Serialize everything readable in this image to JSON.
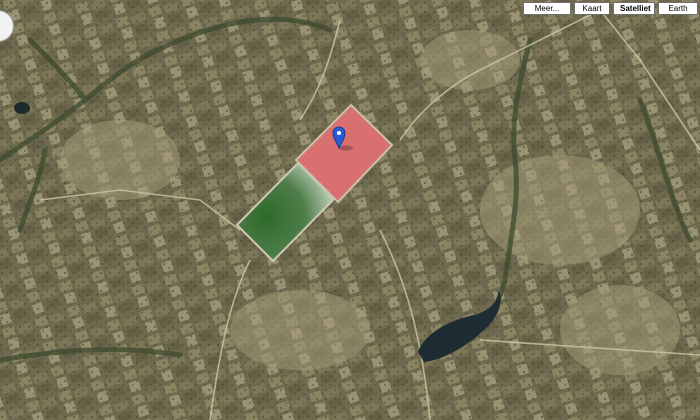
{
  "map": {
    "view": "Satelliet",
    "features": [
      "pink-salt-pond",
      "green-salt-pond",
      "dark-waterhole",
      "dirt-roads",
      "fields"
    ]
  },
  "toolbar": {
    "more_label": "Meer...",
    "map_label": "Kaart",
    "satellite_label": "Satelliet",
    "earth_label": "Earth"
  },
  "marker": {
    "icon": "map-pin-icon",
    "color": "#2a5bd7"
  },
  "colors": {
    "terrain": "#6f6a4f",
    "pink_pond": "#d97070",
    "green_pond": "#2f5a2a",
    "water": "#1f2c33"
  }
}
